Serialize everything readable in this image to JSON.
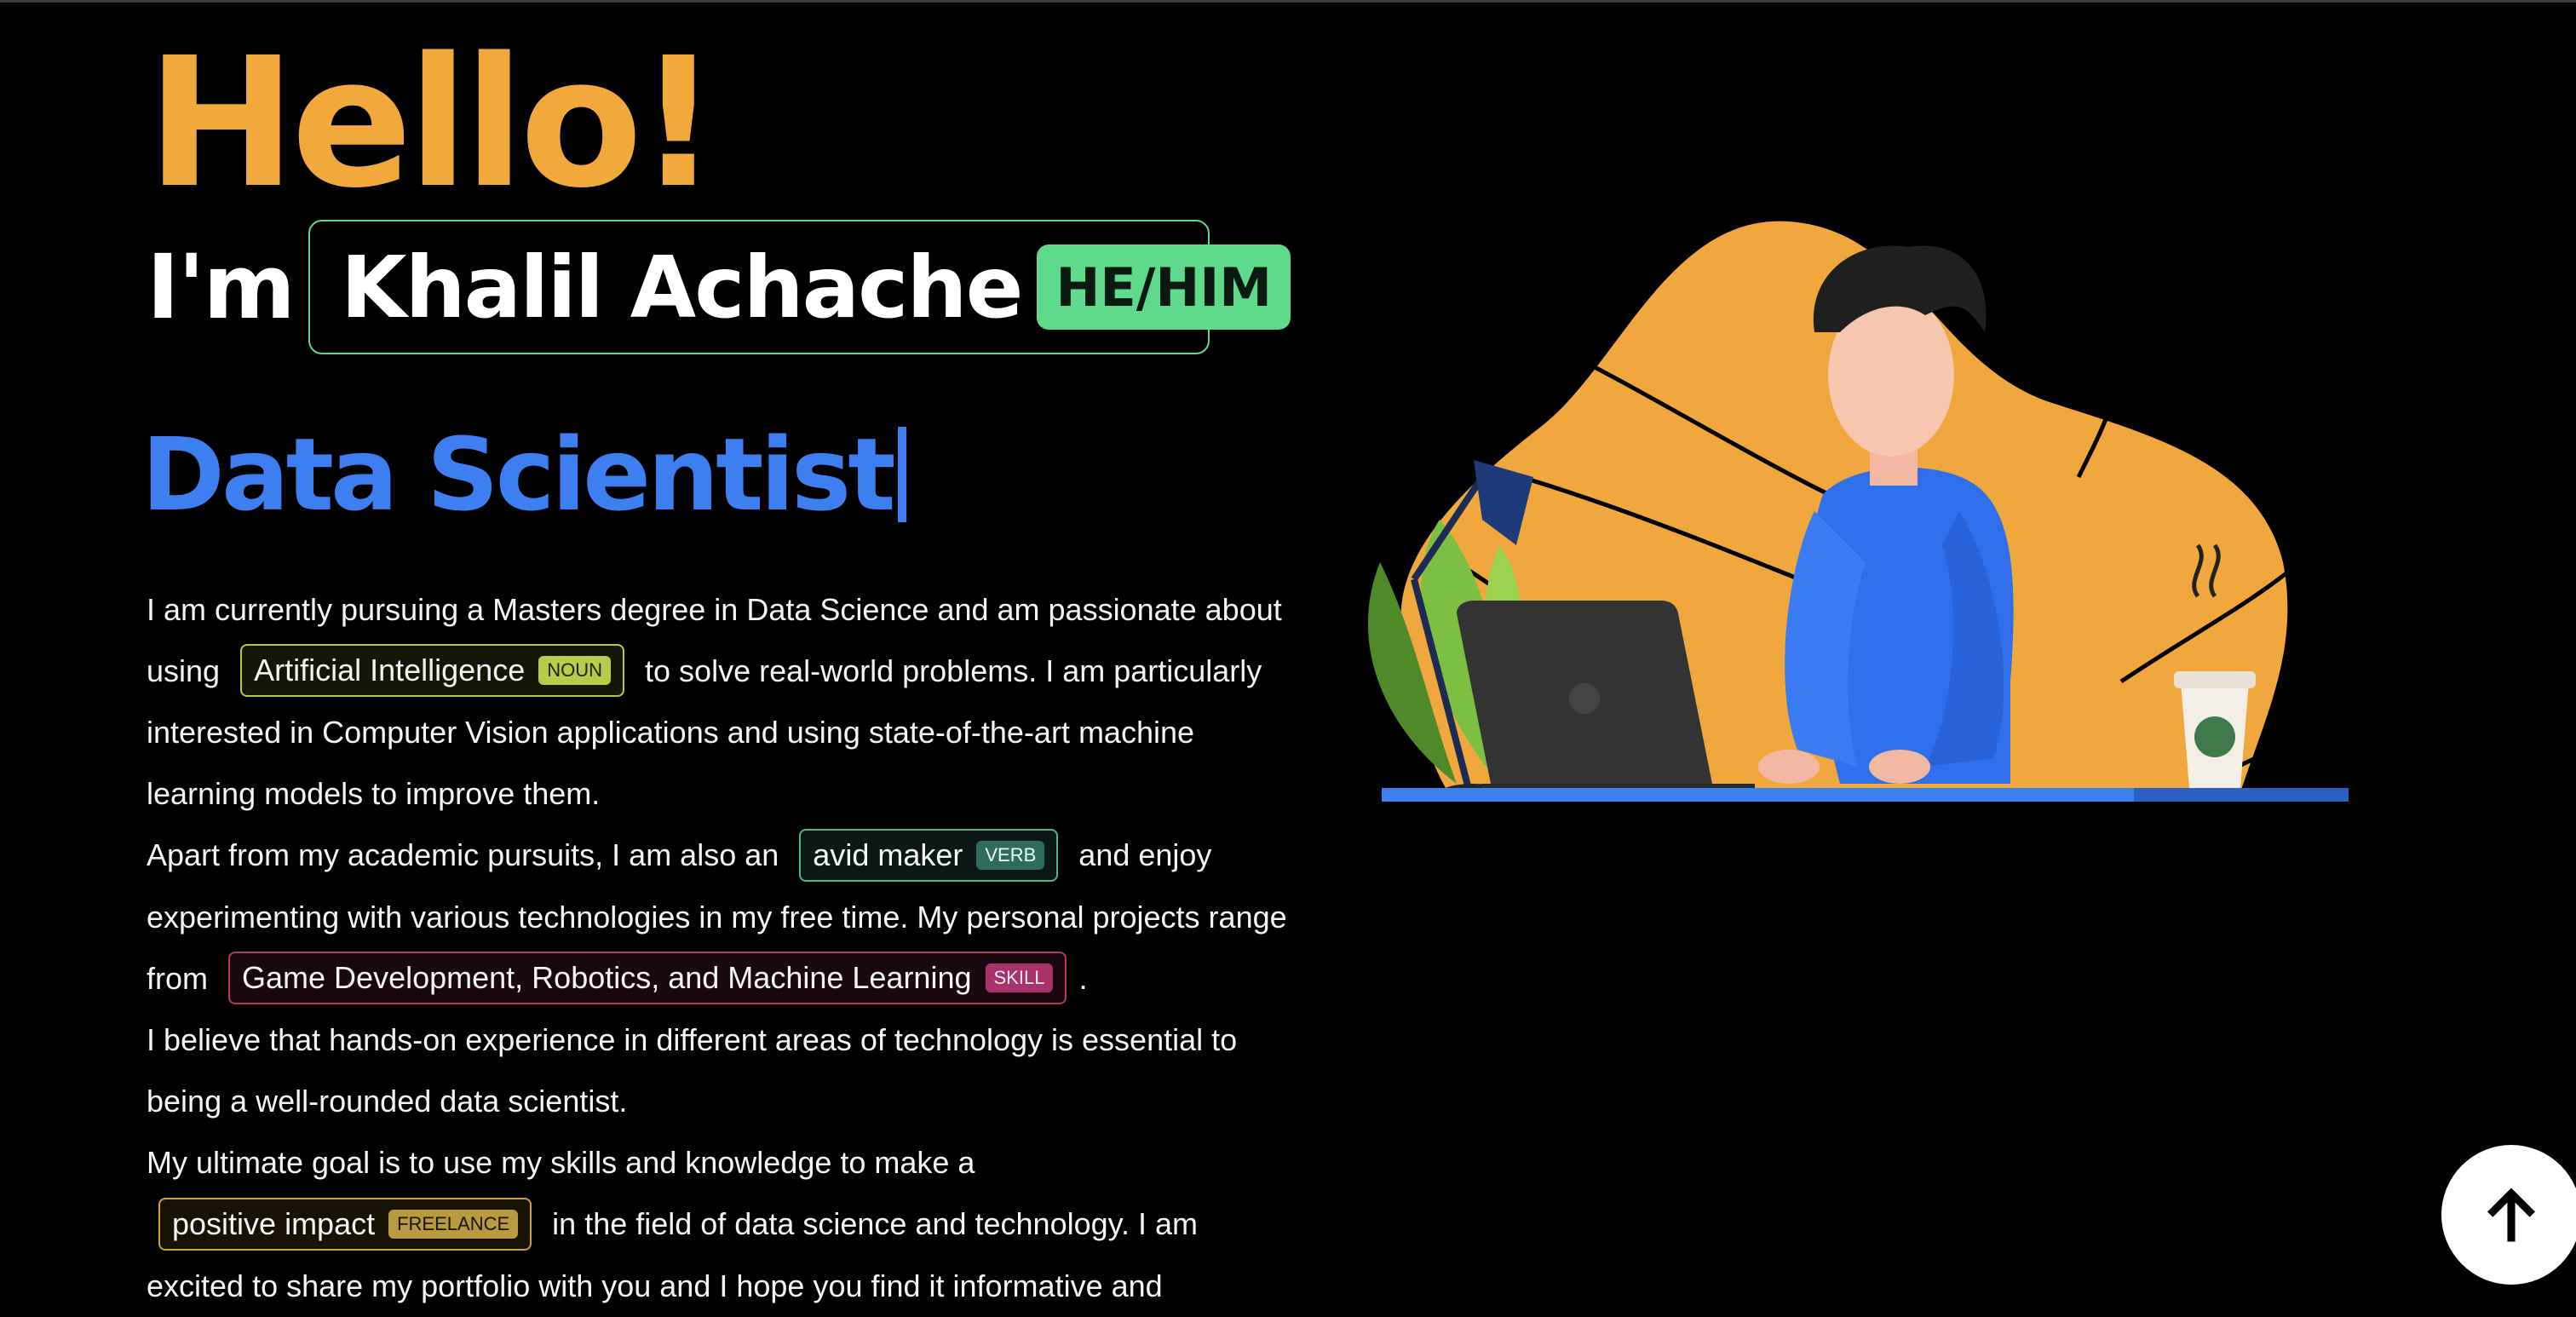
{
  "hero": {
    "greeting": "Hello!",
    "intro": "I'm",
    "name": "Khalil Achache",
    "pronouns": "HE/HIM",
    "role": "Data Scientist"
  },
  "bio": {
    "p1_a": "I am currently pursuing a Masters degree in Data Science and am passionate about using",
    "tag1_text": "Artificial Intelligence",
    "tag1_label": "NOUN",
    "p1_b": "to solve real-world problems. I am particularly interested in Computer Vision applications and using state-of-the-art machine learning models to improve them.",
    "p2_a": "Apart from my academic pursuits, I am also an",
    "tag2_text": "avid maker",
    "tag2_label": "VERB",
    "p2_b": "and enjoy experimenting with various technologies in my free time. My personal projects range from",
    "tag3_text": "Game Development, Robotics, and Machine Learning",
    "tag3_label": "SKILL",
    "p2_c": ".",
    "p3": "I believe that hands-on experience in different areas of technology is essential to being a well-rounded data scientist.",
    "p4_a": "My ultimate goal is to use my skills and knowledge to make a",
    "tag4_text": "positive impact",
    "tag4_label": "FREELANCE",
    "p4_b": "in the field of data science and technology. I am excited to share my portfolio with you and I hope you find it informative and"
  },
  "icons": {
    "scroll_top": "arrow-up-icon",
    "illustration": "person-at-laptop-illustration"
  },
  "colors": {
    "greeting": "#f2a93b",
    "role": "#3d7ef0",
    "name_accent": "#5fd98a",
    "background": "#000000"
  }
}
